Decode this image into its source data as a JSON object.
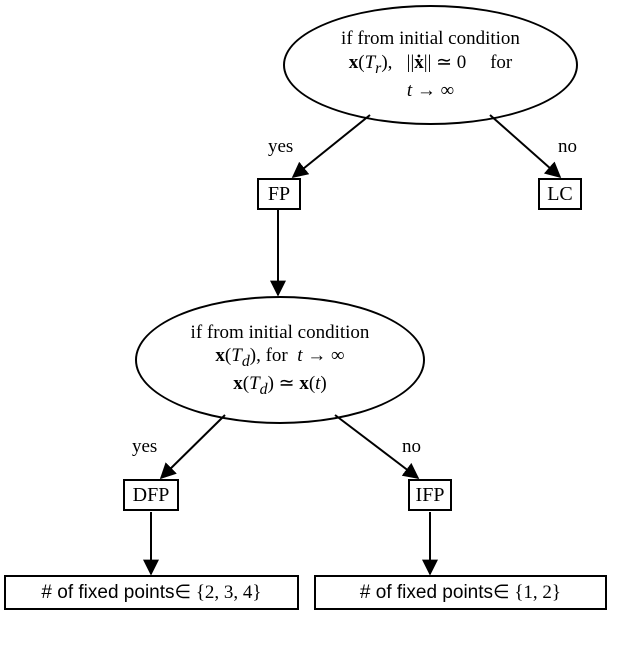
{
  "decision1": {
    "line1_prefix": "if from initial condition",
    "line2_x": "x",
    "line2_paren_open": "(",
    "line2_Tr_T": "T",
    "line2_Tr_r": "r",
    "line2_paren_close": "),",
    "line2_norm_open": "||",
    "line2_xdot": "ẋ",
    "line2_norm_close": "||",
    "line2_sim": " ≃ 0",
    "line2_for": "for",
    "line3_t": "t",
    "line3_arrow": " → ∞"
  },
  "edge1": {
    "yes": "yes",
    "no": "no"
  },
  "node_fp": "FP",
  "node_lc": "LC",
  "decision2": {
    "line1_prefix": "if from initial condition",
    "line2_x": "x",
    "line2_paren_open": "(",
    "line2_Td_T": "T",
    "line2_Td_d": "d",
    "line2_paren_close": "),",
    "line2_for": " for ",
    "line2_t": "t",
    "line2_arrow": " → ∞",
    "line3_x1": "x",
    "line3_paren_open1": "(",
    "line3_Td_T": "T",
    "line3_Td_d": "d",
    "line3_paren_close1": ")",
    "line3_sim": " ≃ ",
    "line3_x2": "x",
    "line3_paren_open2": "(",
    "line3_t": "t",
    "line3_paren_close2": ")"
  },
  "edge2": {
    "yes": "yes",
    "no": "no"
  },
  "node_dfp": "DFP",
  "node_ifp": "IFP",
  "leaf_dfp": {
    "prefix": "# of fixed points",
    "set": " ∈ {2, 3, 4}"
  },
  "leaf_ifp": {
    "prefix": "# of fixed points",
    "set": "  ∈ {1, 2}"
  }
}
